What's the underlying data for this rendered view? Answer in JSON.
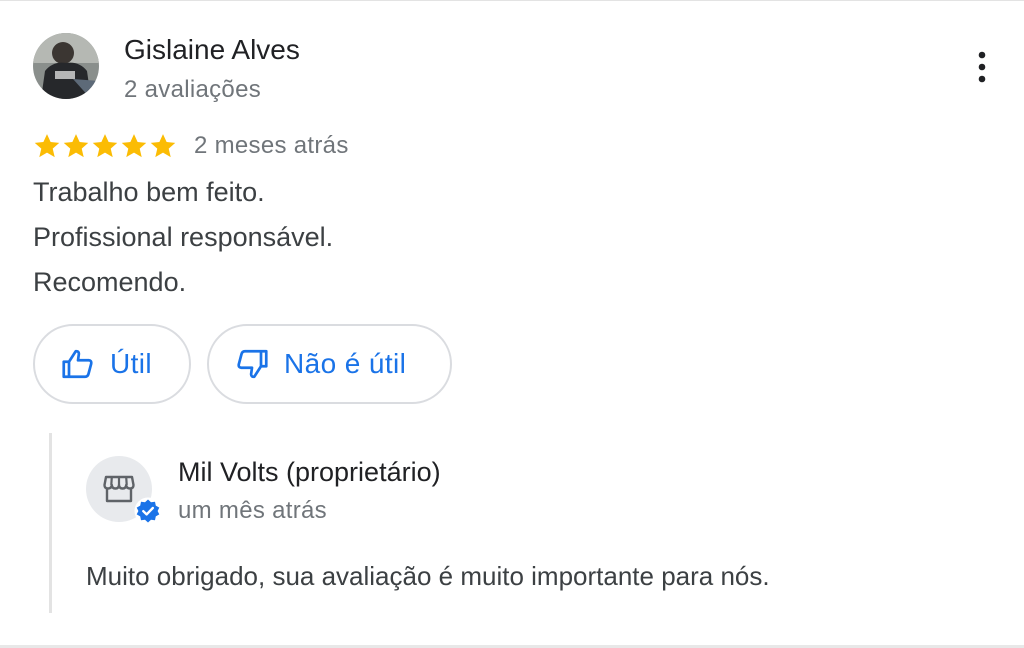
{
  "review": {
    "reviewer_name": "Gislaine Alves",
    "reviewer_meta": "2 avaliações",
    "rating": 5,
    "rating_max": 5,
    "date": "2 meses atrás",
    "text_lines": [
      "Trabalho bem feito.",
      "Profissional responsável.",
      "Recomendo."
    ]
  },
  "actions": {
    "helpful_label": "Útil",
    "not_helpful_label": "Não é útil"
  },
  "owner_reply": {
    "name": "Mil Volts (proprietário)",
    "date": "um mês atrás",
    "text": "Muito obrigado, sua avaliação é muito importante para nós."
  },
  "icons": {
    "more": "more-vertical-icon",
    "star": "star-icon",
    "thumb_up": "thumb-up-icon",
    "thumb_down": "thumb-down-icon",
    "storefront": "storefront-icon",
    "verified": "verified-badge-icon"
  },
  "colors": {
    "star": "#fbbc04",
    "accent": "#1a73e8",
    "text_primary": "#202124",
    "text_secondary": "#70757a",
    "border": "#dadce0"
  }
}
